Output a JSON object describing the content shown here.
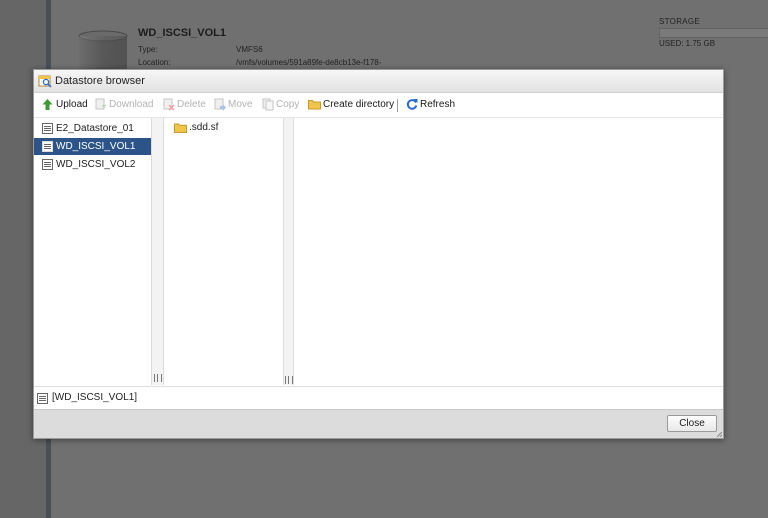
{
  "background": {
    "datastore_name": "WD_ISCSI_VOL1",
    "type_label": "Type:",
    "type_value": "VMFS6",
    "location_label": "Location:",
    "location_value": "/vmfs/volumes/591a89fe-de8cb13e-f178-",
    "storage_label": "STORAGE",
    "used_label": "USED: 1.75 GB"
  },
  "dialog": {
    "title": "Datastore browser",
    "toolbar": {
      "upload": "Upload",
      "download": "Download",
      "delete": "Delete",
      "move": "Move",
      "copy": "Copy",
      "create_directory": "Create directory",
      "refresh": "Refresh"
    },
    "datastores": [
      {
        "name": "E2_Datastore_01",
        "selected": false
      },
      {
        "name": "WD_ISCSI_VOL1",
        "selected": true
      },
      {
        "name": "WD_ISCSI_VOL2",
        "selected": false
      }
    ],
    "files": [
      {
        "name": ".sdd.sf",
        "icon": "folder-icon"
      }
    ],
    "path": "[WD_ISCSI_VOL1]",
    "close_label": "Close"
  },
  "colors": {
    "selection": "#2d5488",
    "folder": "#f2c44c",
    "upload_arrow": "#3c9a35",
    "refresh_arrow": "#2a6bd1"
  }
}
